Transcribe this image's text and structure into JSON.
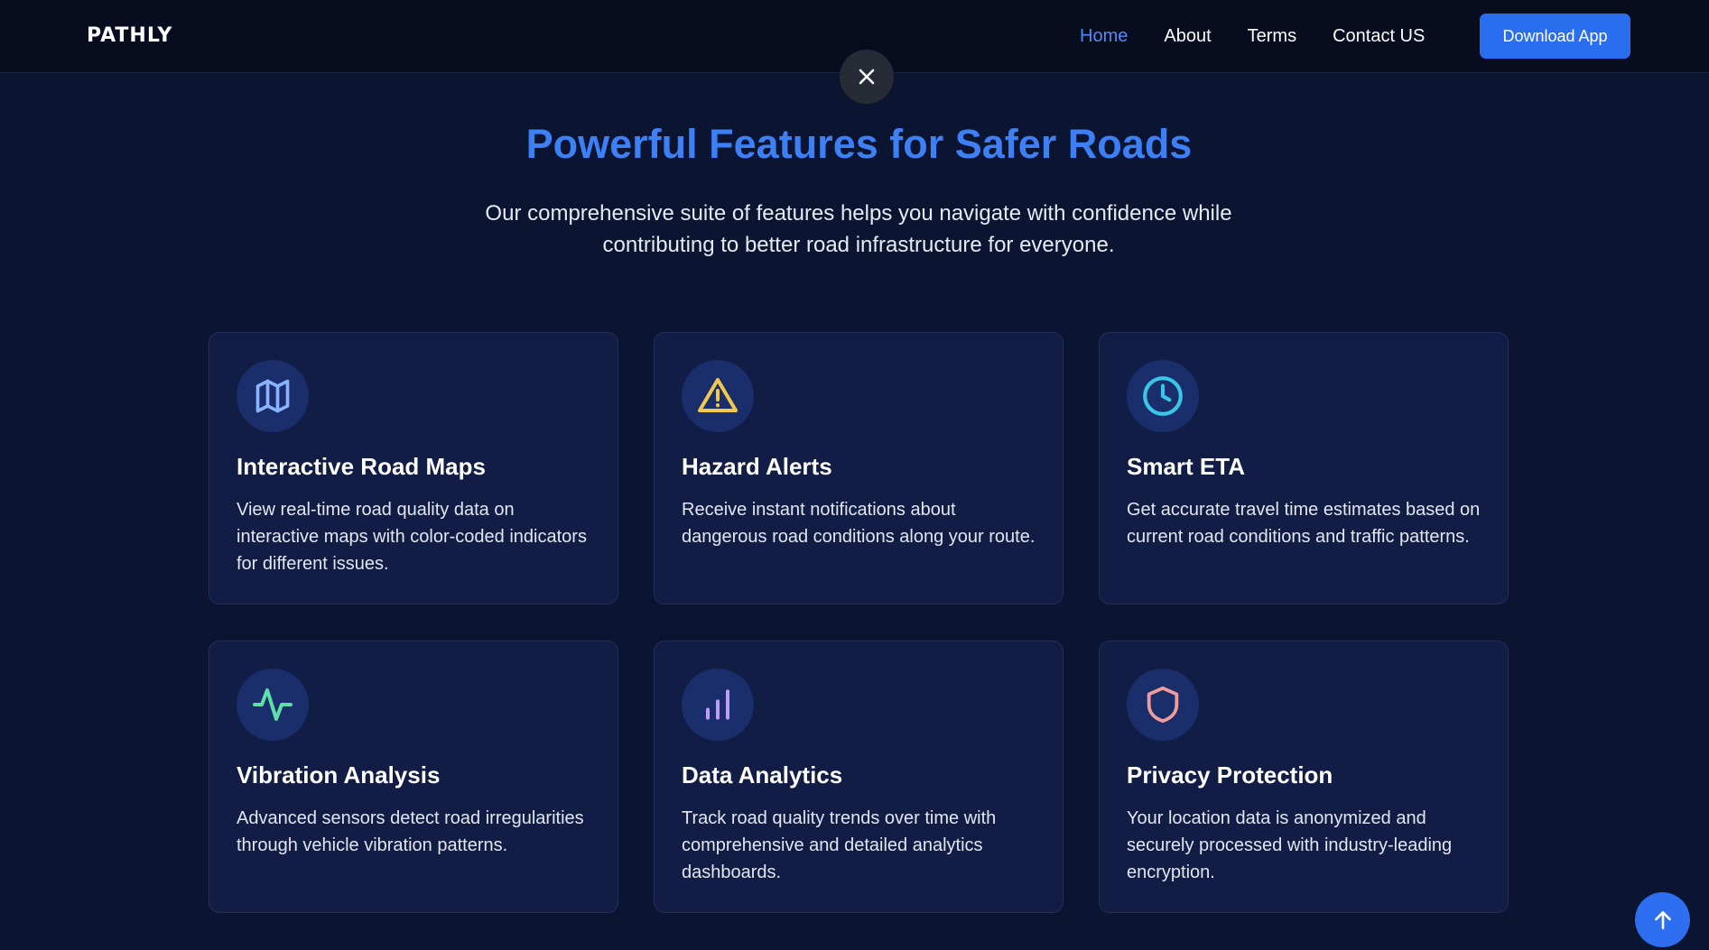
{
  "header": {
    "logo_text": "PATHLY",
    "nav": [
      "Home",
      "About",
      "Terms",
      "Contact US"
    ],
    "active_nav": "Home",
    "download_label": "Download App"
  },
  "section": {
    "title": "Powerful Features for Safer Roads",
    "subtitle": "Our comprehensive suite of features helps you navigate with confidence while contributing to better road infrastructure for everyone."
  },
  "features": [
    {
      "icon": "map-icon",
      "color": "#8ab4ff",
      "title": "Interactive Road Maps",
      "description": "View real-time road quality data on interactive maps with color-coded indicators for different issues."
    },
    {
      "icon": "warning-icon",
      "color": "#f2c94c",
      "title": "Hazard Alerts",
      "description": "Receive instant notifications about dangerous road conditions along your route."
    },
    {
      "icon": "clock-icon",
      "color": "#39c6e8",
      "title": "Smart ETA",
      "description": "Get accurate travel time estimates based on current road conditions and traffic patterns."
    },
    {
      "icon": "activity-icon",
      "color": "#5fe0a8",
      "title": "Vibration Analysis",
      "description": "Advanced sensors detect road irregularities through vehicle vibration patterns."
    },
    {
      "icon": "bar-chart-icon",
      "color": "#c09cf7",
      "title": "Data Analytics",
      "description": "Track road quality trends over time with comprehensive and detailed analytics dashboards."
    },
    {
      "icon": "shield-icon",
      "color": "#f39a9a",
      "title": "Privacy Protection",
      "description": "Your location data is anonymized and securely processed with industry-leading encryption."
    }
  ],
  "colors": {
    "background": "#0b1430",
    "card": "#111d45",
    "accent": "#2a6ef0",
    "heading": "#3d7ff4"
  }
}
